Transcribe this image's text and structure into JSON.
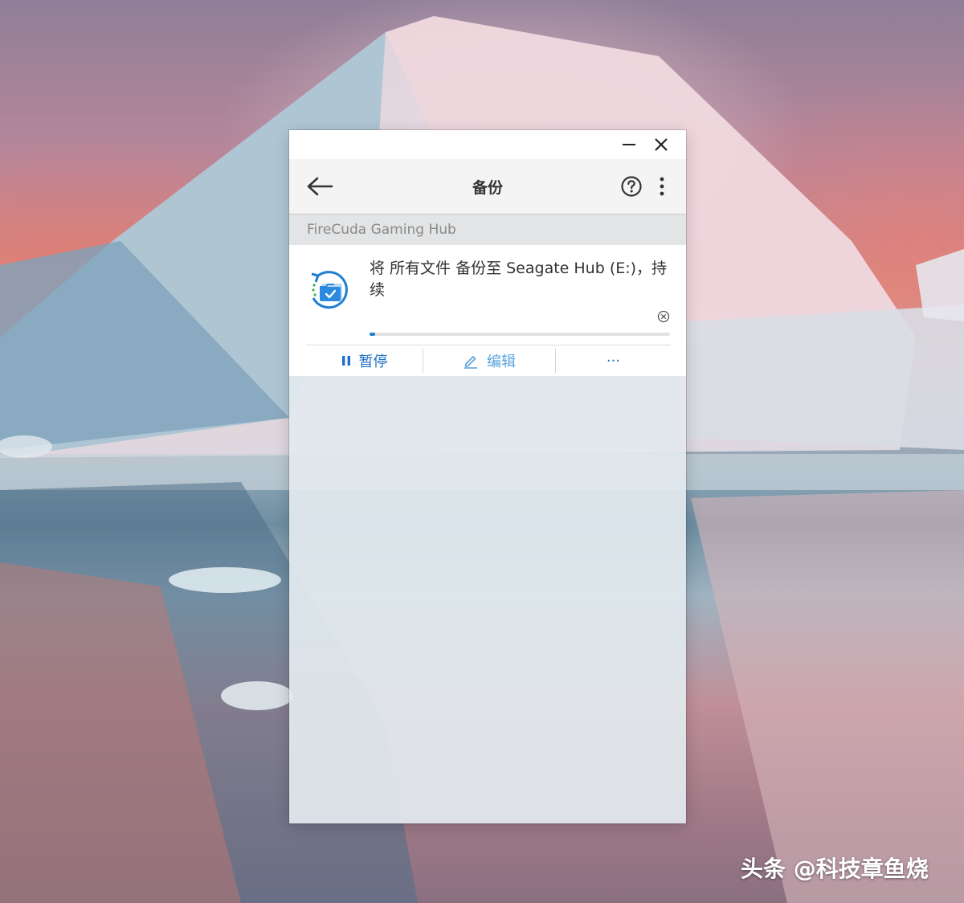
{
  "window": {
    "minimize_icon": "minimize-icon",
    "close_icon": "close-icon"
  },
  "header": {
    "back_icon": "arrow-left-icon",
    "title": "备份",
    "help_icon": "question-circle-icon",
    "more_icon": "more-vertical-icon"
  },
  "section": {
    "title": "FireCuda Gaming Hub"
  },
  "backup_card": {
    "icon": "backup-folder-sync-icon",
    "description": "将 所有文件 备份至 Seagate Hub (E:)，持续",
    "progress_fraction": 0.02,
    "dismiss_icon": "close-circle-icon",
    "actions": [
      {
        "label": "暂停",
        "icon": "pause-icon"
      },
      {
        "label": "编辑",
        "icon": "pencil-icon"
      },
      {
        "label": "···",
        "icon": "more-horizontal-icon"
      }
    ]
  },
  "colors": {
    "accent": "#1f6fc4",
    "progress": "#1f7fd0"
  },
  "watermark": "头条 @科技章鱼烧"
}
